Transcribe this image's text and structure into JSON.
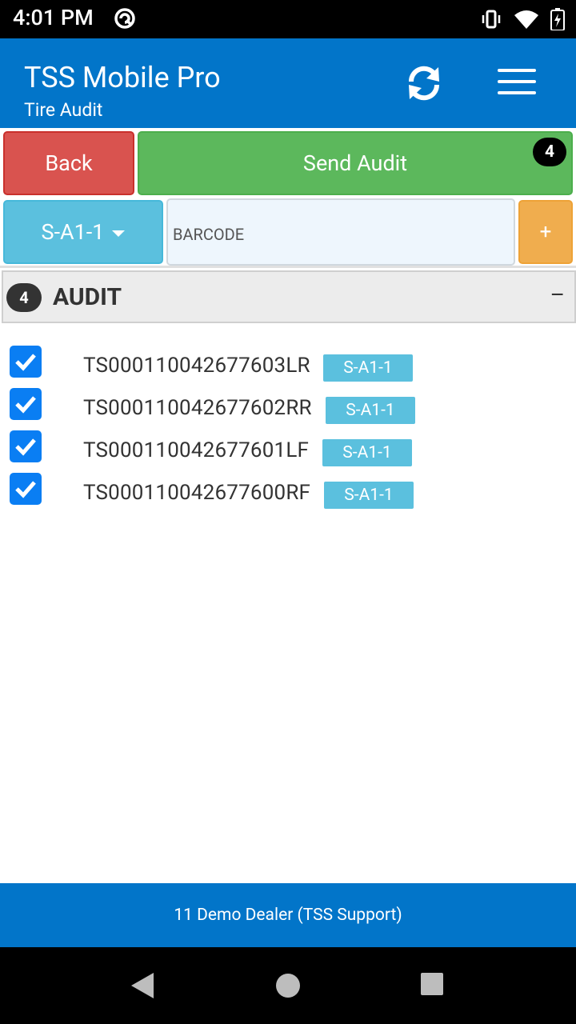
{
  "status_bar": {
    "time": "4:01 PM",
    "battery_level": "4"
  },
  "app": {
    "title": "TSS Mobile Pro",
    "subtitle": "Tire Audit"
  },
  "toolbar": {
    "back_label": "Back",
    "send_label": "Send Audit",
    "send_count": "4",
    "location_label": "S-A1-1",
    "barcode_placeholder": "BARCODE",
    "barcode_value": "",
    "add_label": "+"
  },
  "audit_section": {
    "count": "4",
    "title": "AUDIT",
    "collapse_label": "–",
    "items": [
      {
        "id": "TS000110042677603LR",
        "location": "S-A1-1",
        "checked": true
      },
      {
        "id": "TS000110042677602RR",
        "location": "S-A1-1",
        "checked": true
      },
      {
        "id": "TS000110042677601LF",
        "location": "S-A1-1",
        "checked": true
      },
      {
        "id": "TS000110042677600RF",
        "location": "S-A1-1",
        "checked": true
      }
    ]
  },
  "footer": {
    "text": "11 Demo Dealer (TSS Support)"
  },
  "colors": {
    "primary": "#0275c9",
    "danger": "#d9534f",
    "success": "#5cb85c",
    "info": "#5bc0de",
    "warning": "#f0ad4e"
  }
}
